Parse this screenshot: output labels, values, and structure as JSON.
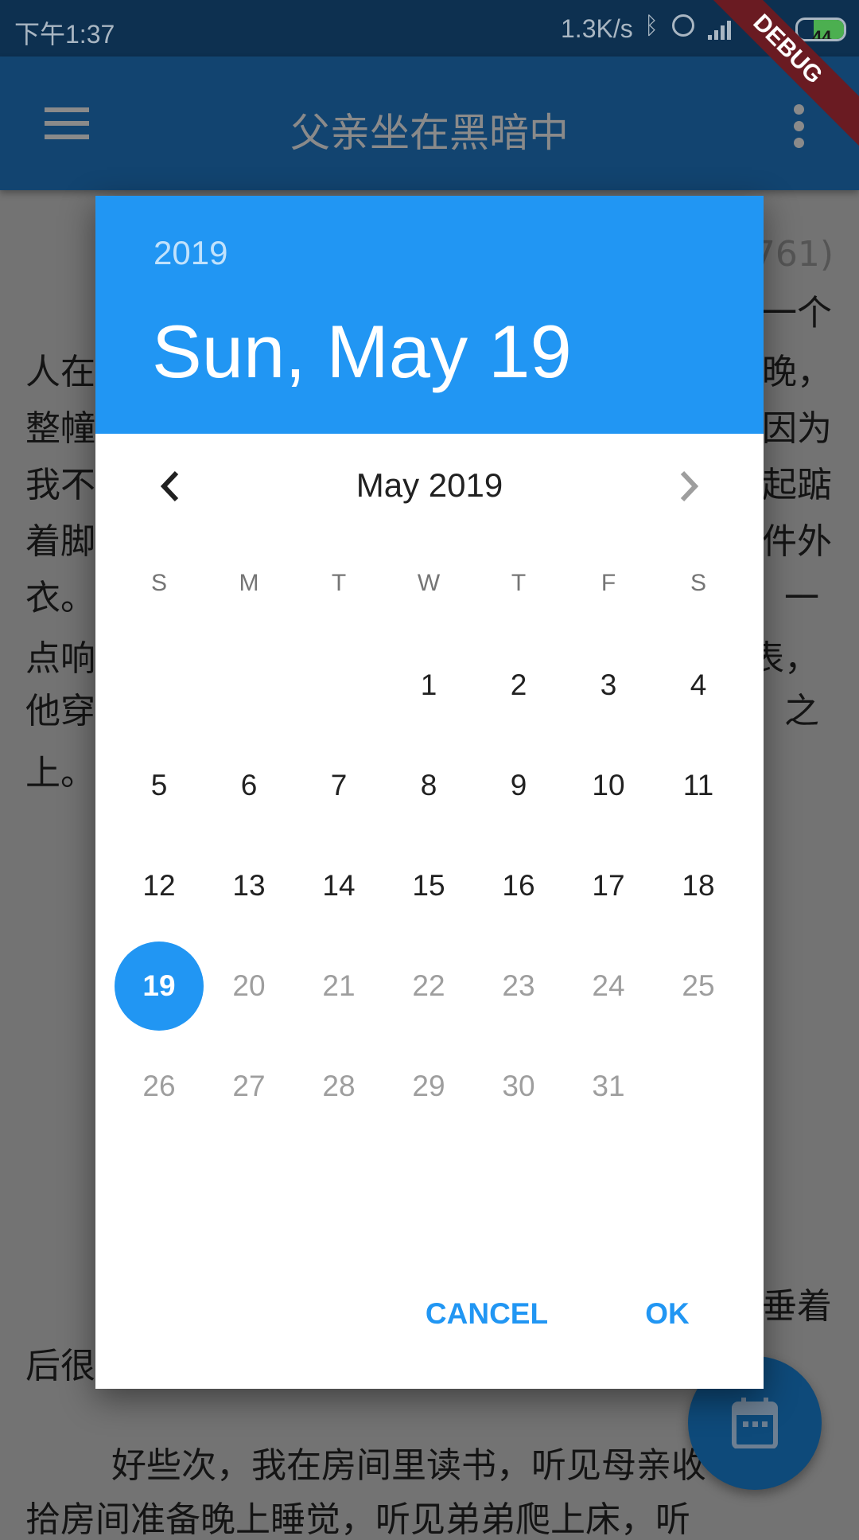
{
  "status_bar": {
    "time": "下午1:37",
    "net_speed": "1.3K/s",
    "battery": "44",
    "icons": [
      "bluetooth-icon",
      "alarm-icon",
      "signal-icon",
      "wifi-icon",
      "battery-icon"
    ]
  },
  "debug_banner": "DEBUG",
  "app_bar": {
    "title": "父亲坐在黑暗中",
    "menu_icon": "menu-icon",
    "more_icon": "more-vert-icon"
  },
  "background_text": {
    "fragments_right": [
      "761)",
      "一个",
      "晚，",
      "因为",
      "起踮",
      "件外",
      "一",
      "表，",
      "之",
      "垂着"
    ],
    "fragments_left": [
      "人在",
      "整幢",
      "我不",
      "着脚",
      "衣。",
      "点响",
      "他穿",
      "上。",
      "后很"
    ],
    "paragraph_line1": "好些次，我在房间里读书，听见母亲收",
    "paragraph_line2": "拾房间准备晚上睡觉，听见弟弟爬上床，听"
  },
  "date_picker": {
    "year": "2019",
    "selected_date": "Sun, May 19",
    "month_label": "May 2019",
    "weekdays": [
      "S",
      "M",
      "T",
      "W",
      "T",
      "F",
      "S"
    ],
    "days": [
      "1",
      "2",
      "3",
      "4",
      "5",
      "6",
      "7",
      "8",
      "9",
      "10",
      "11",
      "12",
      "13",
      "14",
      "15",
      "16",
      "17",
      "18",
      "19",
      "20",
      "21",
      "22",
      "23",
      "24",
      "25",
      "26",
      "27",
      "28",
      "29",
      "30",
      "31"
    ],
    "first_weekday_index": 3,
    "selected_day": 19,
    "last_enabled_day": 19,
    "cancel_label": "CANCEL",
    "ok_label": "OK",
    "accent": "#2196F3"
  },
  "fab": {
    "icon": "calendar-icon",
    "color": "#0e4a7a"
  }
}
